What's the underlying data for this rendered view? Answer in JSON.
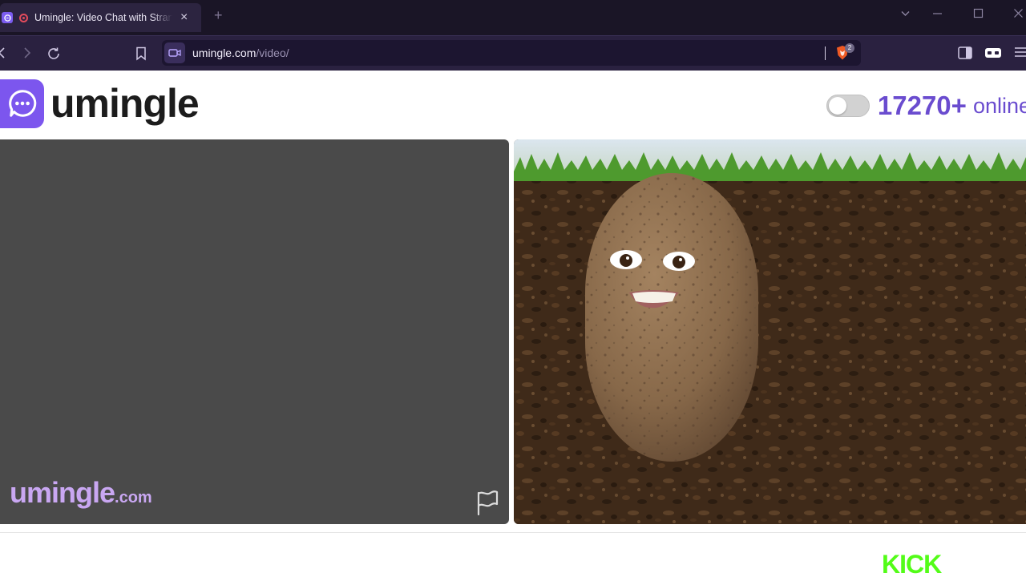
{
  "browser": {
    "tab_title": "Umingle: Video Chat with Strangers",
    "tab_close": "×",
    "new_tab": "+",
    "url_domain": "umingle.com",
    "url_path": "/video/",
    "brave_badge": "2"
  },
  "header": {
    "brand_name": "umingle",
    "online_count": "17270+",
    "online_label": "online"
  },
  "local_video": {
    "watermark_main": "umingle",
    "watermark_suffix": ".com"
  },
  "footer": {
    "ad_label": "KICK"
  },
  "colors": {
    "brand_purple": "#7c56ee",
    "online_text": "#6a4ccf",
    "kick_green": "#53fc18"
  }
}
